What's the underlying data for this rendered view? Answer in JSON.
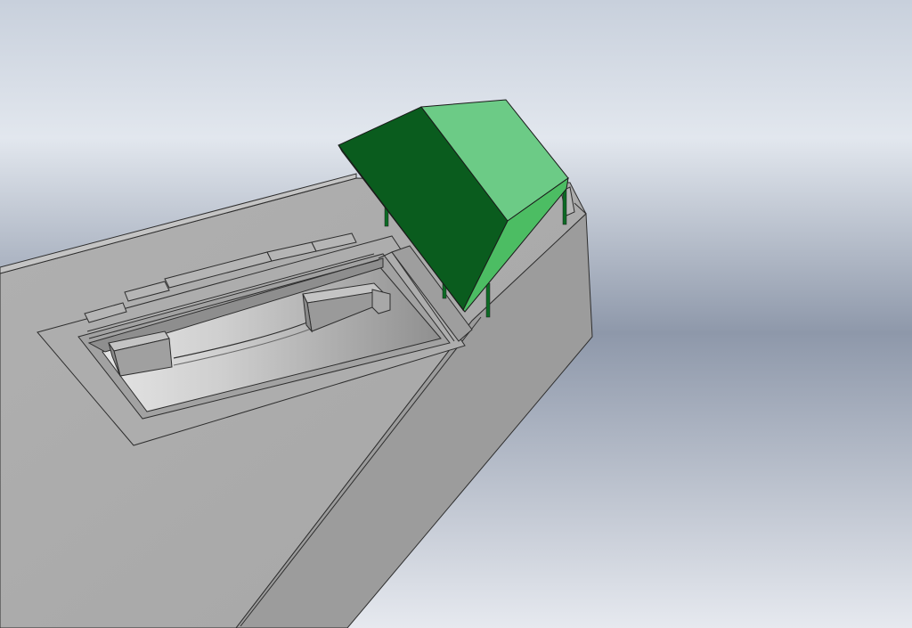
{
  "scene": {
    "background_gradient": [
      "#c8d0dc",
      "#e2e7ee",
      "#8e98aa",
      "#e6e9ef"
    ],
    "body_face_color": "#a9a9a9",
    "body_side_color": "#9c9c9c",
    "edge_color": "#2e2e2e",
    "recess_floor_color": "#b9b9b9",
    "cover_top_color": "#6ccb86",
    "cover_side_color": "#0a5c1e",
    "cover_front_color": "#4cbd63",
    "cover_leg_color": "#0c6a24"
  }
}
